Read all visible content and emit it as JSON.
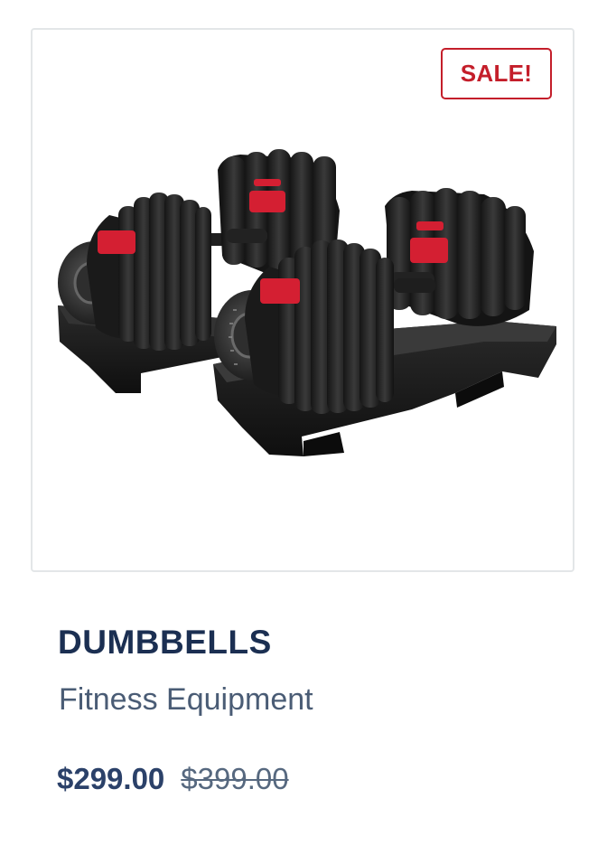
{
  "product": {
    "badge": "SALE!",
    "name": "DUMBBELLS",
    "category": "Fitness Equipment",
    "price_current": "$299.00",
    "price_original": "$399.00",
    "image_icon": "adjustable-dumbbells-image"
  },
  "colors": {
    "accent_red": "#c41e2a",
    "title_navy": "#1b2f52",
    "category_gray": "#4a5c75",
    "price_navy": "#2b4169"
  }
}
